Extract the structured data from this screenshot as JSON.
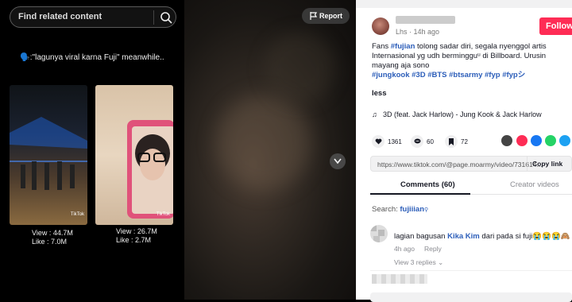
{
  "search": {
    "placeholder": "Find related content"
  },
  "caption": "🗣️:\"lagunya viral karna Fuji\" meanwhile..",
  "videos": [
    {
      "views": "View : 44.7M",
      "likes": "Like : 7.0M",
      "watermark": "TikTok"
    },
    {
      "views": "View : 26.7M",
      "likes": "Like : 2.7M",
      "watermark": "TikTok"
    }
  ],
  "player": {
    "report_label": "Report"
  },
  "post": {
    "meta": "Lhs · 14h ago",
    "follow_label": "Follow",
    "text1": "Fans ",
    "tag_fujian": "#fujian",
    "text2": " tolong sadar diri, segala nyenggol artis Internasional yg udh bermingguᵘ di Billboard. Urusin mayang aja sono",
    "tags": "#jungkook #3D #BTS #btsarmy #fyp #fypシ",
    "less_label": "less",
    "music": "3D (feat. Jack Harlow) - Jung Kook & Jack Harlow"
  },
  "actions": {
    "likes": "1361",
    "comments": "60",
    "saves": "72"
  },
  "share": {
    "url": "https://www.tiktok.com/@page.moarmy/video/731614...",
    "copy_label": "Copy link"
  },
  "tabs": {
    "comments": "Comments (60)",
    "creator": "Creator videos"
  },
  "comment_search": {
    "label": "Search: ",
    "query": "fujiiian"
  },
  "comment": {
    "pre": "lagian bagusan ",
    "mention": "Kika Kim",
    "post": " dari pada si fuji😭😭😭🙈",
    "time": "4h ago",
    "reply_label": "Reply",
    "view_replies": "View 3 replies ⌄"
  },
  "colors": {
    "accent": "#fe2c55",
    "tag": "#2b5db9"
  }
}
